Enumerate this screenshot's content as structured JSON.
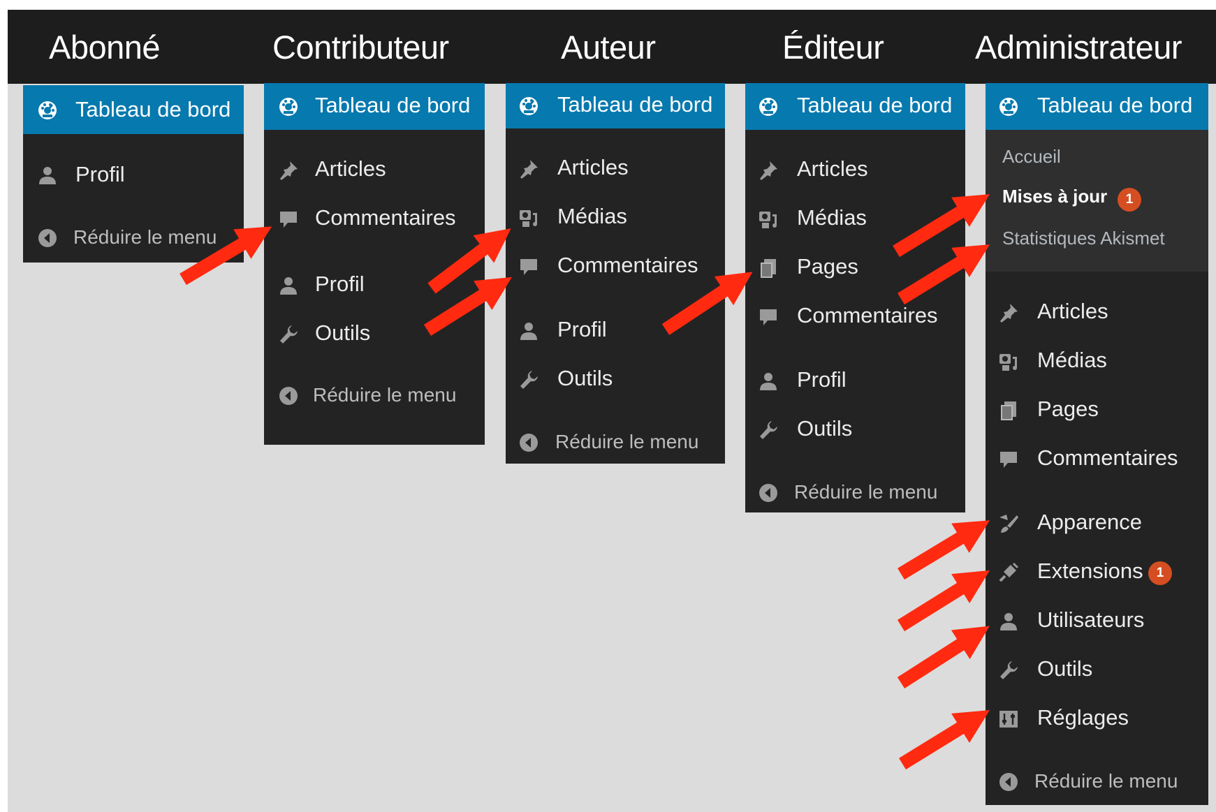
{
  "roles": [
    {
      "title": "Abonné"
    },
    {
      "title": "Contributeur"
    },
    {
      "title": "Auteur"
    },
    {
      "title": "Éditeur"
    },
    {
      "title": "Administrateur"
    }
  ],
  "dashboard_label": "Tableau de bord",
  "collapse_label": "Réduire le menu",
  "items": {
    "profil": "Profil",
    "articles": "Articles",
    "commentaires": "Commentaires",
    "outils": "Outils",
    "medias": "Médias",
    "pages": "Pages",
    "apparence": "Apparence",
    "extensions": "Extensions",
    "utilisateurs": "Utilisateurs",
    "reglages": "Réglages"
  },
  "admin_submenu": {
    "accueil": "Accueil",
    "mises_a_jour": "Mises à jour",
    "statistiques": "Statistiques Akismet"
  },
  "badges": {
    "updates_count": "1",
    "extensions_count": "1"
  },
  "colors": {
    "menu_bg": "#232323",
    "active_bg": "#0679ae",
    "badge": "#d54e21",
    "arrow": "#ff2a10",
    "page_bg": "#dcdcdc"
  }
}
